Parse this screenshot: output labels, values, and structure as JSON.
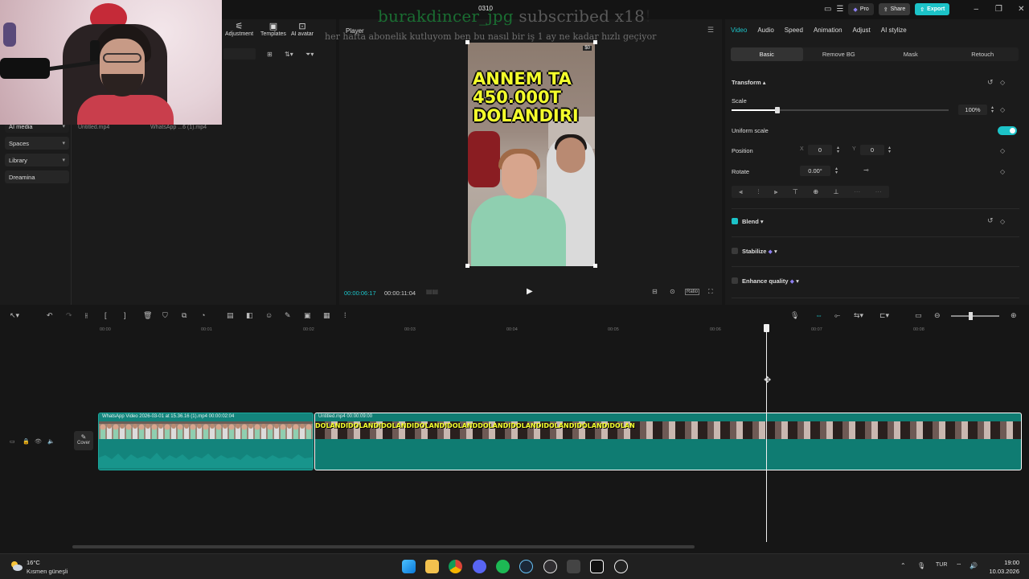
{
  "window": {
    "title": "0310"
  },
  "titlebar": {
    "pro_label": "Pro",
    "share_label": "Share",
    "export_label": "Export"
  },
  "stream_overlay": {
    "sub_name": "burakdincer_jpg",
    "sub_text": " subscribed x18",
    "sub_exclaim": "!",
    "message": "her hafta abonelik kutluyom ben bu nasıl bir iş 1 ay ne kadar hızlı geçiyor"
  },
  "left_panel": {
    "tools": [
      {
        "icon": "adjustment-icon",
        "label": "Adjustment"
      },
      {
        "icon": "templates-icon",
        "label": "Templates"
      },
      {
        "icon": "ai-avatar-icon",
        "label": "AI avatar"
      }
    ],
    "nav": [
      {
        "label": "AI media"
      },
      {
        "label": "Spaces"
      },
      {
        "label": "Library"
      },
      {
        "label": "Dreamina"
      }
    ],
    "media": [
      {
        "name": "Untitled.mp4"
      },
      {
        "name": "WhatsApp ...6 (1).mp4"
      }
    ]
  },
  "player": {
    "title": "Player",
    "current_time": "00:00:06:17",
    "total_time": "00:00:11:04",
    "preview_caption": [
      "ANNEM TA",
      "450.000T",
      "DOLANDIRI"
    ],
    "preview_badge": "$0",
    "ratio_label": "Ratio"
  },
  "inspector": {
    "tabs": [
      "Video",
      "Audio",
      "Speed",
      "Animation",
      "Adjust",
      "AI stylize"
    ],
    "active_tab": "Video",
    "subtabs": [
      "Basic",
      "Remove BG",
      "Mask",
      "Retouch"
    ],
    "active_subtab": "Basic",
    "transform_label": "Transform",
    "scale_label": "Scale",
    "scale_value": "100%",
    "scale_level": 0.21,
    "uniform_scale_label": "Uniform scale",
    "uniform_scale_on": true,
    "position_label": "Position",
    "position_x_axis": "X",
    "position_x": "0",
    "position_y_axis": "Y",
    "position_y": "0",
    "rotate_label": "Rotate",
    "rotate_value": "0.00°",
    "blend_label": "Blend",
    "stabilize_label": "Stabilize",
    "enhance_label": "Enhance quality"
  },
  "timeline": {
    "ruler": [
      "00:00",
      "00:01",
      "00:02",
      "00:03",
      "00:04",
      "00:05",
      "00:06",
      "00:07",
      "00:08"
    ],
    "clip1_title": "WhatsApp Video 2026-03-01 at 15.36.16 (1).mp4   00:00:02:04",
    "clip2_title": "Untitled.mp4   00:00:09:00",
    "clip2_caption": "DOLANDIDOLANDIDOLANDIDOLANDIDOLANDDOLANDIDOLANDIDOLANDIDOLANDIDOLAN",
    "cover_label": "Cover"
  },
  "taskbar": {
    "temp": "16°C",
    "weather": "Kısmen güneşli",
    "language": "TUR",
    "time": "19:00",
    "date": "10.03.2026"
  },
  "colors": {
    "accent": "#1cc3c8",
    "clip": "#13847c",
    "caption_yellow": "#f4ff2c"
  }
}
